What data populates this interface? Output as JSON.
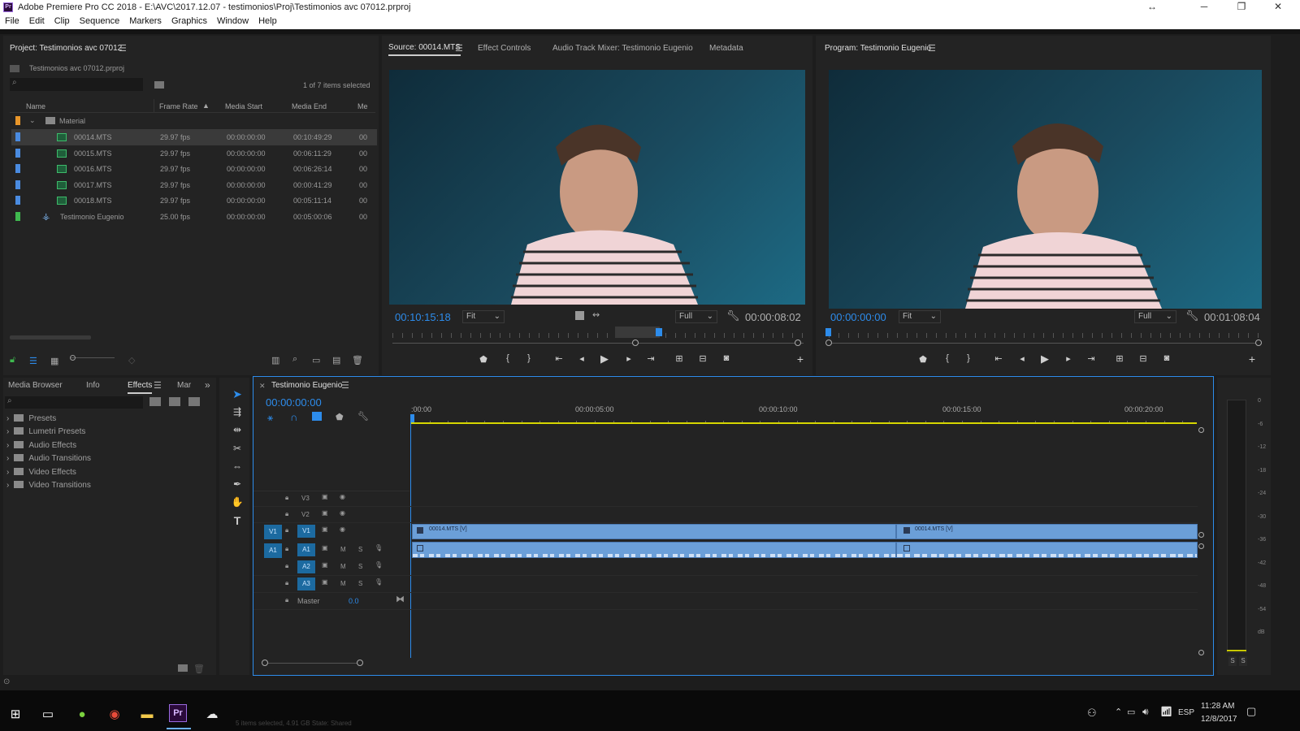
{
  "window": {
    "title": "Adobe Premiere Pro CC 2018 - E:\\AVC\\2017.12.07 - testimonios\\Proj\\Testimonios avc 07012.prproj",
    "minimize": "─",
    "restore": "❐",
    "close": "✕",
    "resize": "↔"
  },
  "menu": [
    "File",
    "Edit",
    "Clip",
    "Sequence",
    "Markers",
    "Graphics",
    "Window",
    "Help"
  ],
  "project": {
    "tab": "Project: Testimonios avc 07012",
    "file": "Testimonios avc 07012.prproj",
    "selection": "1 of 7 items selected",
    "columns": [
      "Name",
      "Frame Rate",
      "Media Start",
      "Media End",
      "Me"
    ],
    "folder": "Material",
    "rows": [
      {
        "name": "00014.MTS",
        "fps": "29.97 fps",
        "start": "00:00:00:00",
        "end": "00:10:49:29",
        "me": "00",
        "color": "#4a8be0"
      },
      {
        "name": "00015.MTS",
        "fps": "29.97 fps",
        "start": "00:00:00:00",
        "end": "00:06:11:29",
        "me": "00",
        "color": "#4a8be0"
      },
      {
        "name": "00016.MTS",
        "fps": "29.97 fps",
        "start": "00:00:00:00",
        "end": "00:06:26:14",
        "me": "00",
        "color": "#4a8be0"
      },
      {
        "name": "00017.MTS",
        "fps": "29.97 fps",
        "start": "00:00:00:00",
        "end": "00:00:41:29",
        "me": "00",
        "color": "#4a8be0"
      },
      {
        "name": "00018.MTS",
        "fps": "29.97 fps",
        "start": "00:00:00:00",
        "end": "00:05:11:14",
        "me": "00",
        "color": "#4a8be0"
      },
      {
        "name": "Testimonio Eugenio",
        "fps": "25.00 fps",
        "start": "00:00:00:00",
        "end": "00:05:00:06",
        "me": "00",
        "color": "#3fb94f"
      }
    ]
  },
  "source": {
    "tabs": [
      "Source: 00014.MTS",
      "Effect Controls",
      "Audio Track Mixer: Testimonio Eugenio",
      "Metadata"
    ],
    "timecode": "00:10:15:18",
    "fit": "Fit",
    "res": "Full",
    "duration": "00:00:08:02"
  },
  "program": {
    "tab": "Program: Testimonio Eugenio",
    "timecode": "00:00:00:00",
    "fit": "Fit",
    "res": "Full",
    "duration": "00:01:08:04"
  },
  "effects": {
    "tabs": [
      "Media Browser",
      "Info",
      "Effects",
      "Mar"
    ],
    "items": [
      "Presets",
      "Lumetri Presets",
      "Audio Effects",
      "Audio Transitions",
      "Video Effects",
      "Video Transitions"
    ]
  },
  "timeline": {
    "tab": "Testimonio Eugenio",
    "timecode": "00:00:00:00",
    "ruler": [
      ":00:00",
      "00:00:05:00",
      "00:00:10:00",
      "00:00:15:00",
      "00:00:20:00"
    ],
    "tracks": {
      "v3": "V3",
      "v2": "V2",
      "v1": "V1",
      "a1": "A1",
      "a2": "A2",
      "a3": "A3",
      "master": "Master",
      "master_val": "0.0",
      "src_v": "V1",
      "src_a": "A1",
      "m": "M",
      "s": "S"
    },
    "clip1": "00014.MTS [V]",
    "clip2": "00014.MTS [V]"
  },
  "meter": {
    "labels": [
      "0",
      "-6",
      "-12",
      "-18",
      "-24",
      "-30",
      "-36",
      "-42",
      "-48",
      "-54",
      "dB"
    ],
    "solo": [
      "S",
      "S"
    ]
  },
  "taskbar": {
    "time": "11:28 AM",
    "date": "12/8/2017",
    "lang": "ESP",
    "status": "5 items selected, 4.91 GB   State: Shared"
  },
  "colors": {
    "accent": "#2d8ceb",
    "yellow": "#d6d600",
    "clip": "#6b9fd8"
  }
}
